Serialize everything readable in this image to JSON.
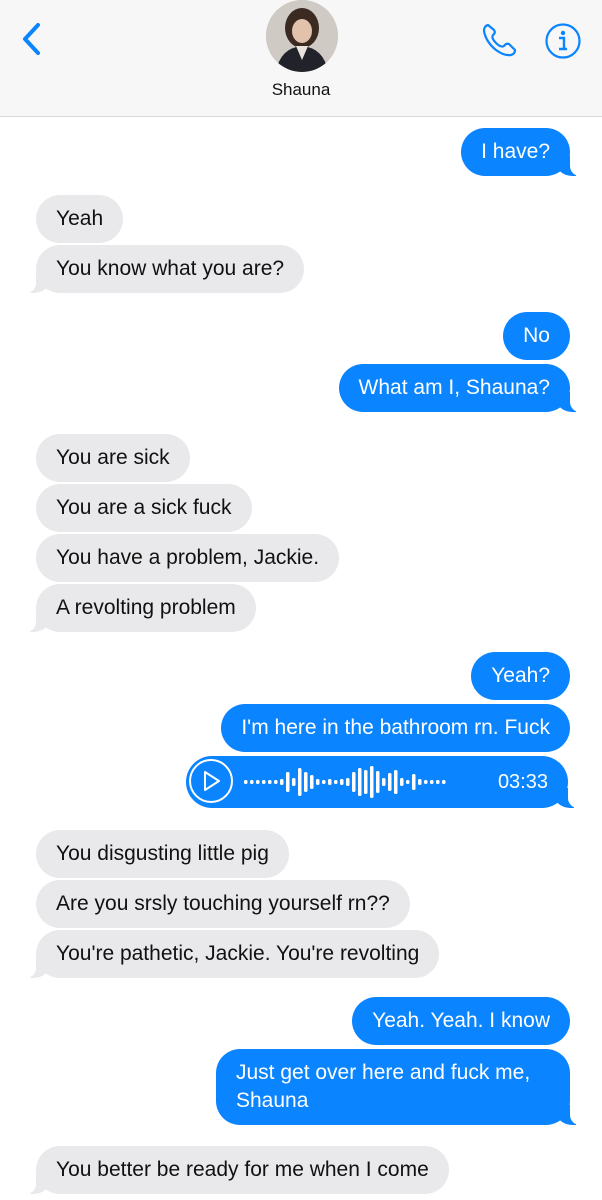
{
  "header": {
    "contact_name": "Shauna",
    "icons": {
      "back": "chevron-left-icon",
      "phone": "phone-icon",
      "info": "info-icon"
    },
    "accent_color": "#0a84ff"
  },
  "messages": [
    {
      "dir": "out",
      "text": "I have?"
    },
    {
      "dir": "in",
      "text": "Yeah"
    },
    {
      "dir": "in",
      "text": "You know what you are?"
    },
    {
      "dir": "out",
      "text": "No"
    },
    {
      "dir": "out",
      "text": "What am I, Shauna?"
    },
    {
      "dir": "in",
      "text": "You are sick"
    },
    {
      "dir": "in",
      "text": "You are a sick fuck"
    },
    {
      "dir": "in",
      "text": "You have a problem, Jackie."
    },
    {
      "dir": "in",
      "text": "A revolting problem"
    },
    {
      "dir": "out",
      "text": "Yeah?"
    },
    {
      "dir": "out",
      "text": "I'm here in the bathroom rn. Fuck"
    },
    {
      "dir": "in",
      "text": "You disgusting little pig"
    },
    {
      "dir": "in",
      "text": "Are you srsly touching yourself rn??"
    },
    {
      "dir": "in",
      "text": "You're pathetic, Jackie. You're revolting"
    },
    {
      "dir": "out",
      "text": "Yeah. Yeah. I know"
    },
    {
      "dir": "out",
      "text": "Just get over here and fuck me, Shauna"
    },
    {
      "dir": "in",
      "text": "You better be ready for me when I come"
    }
  ],
  "audio_message": {
    "dir": "out",
    "duration": "03:33",
    "icon": "play-icon"
  },
  "colors": {
    "incoming": "#e9e9eb",
    "outgoing": "#0a84ff"
  }
}
